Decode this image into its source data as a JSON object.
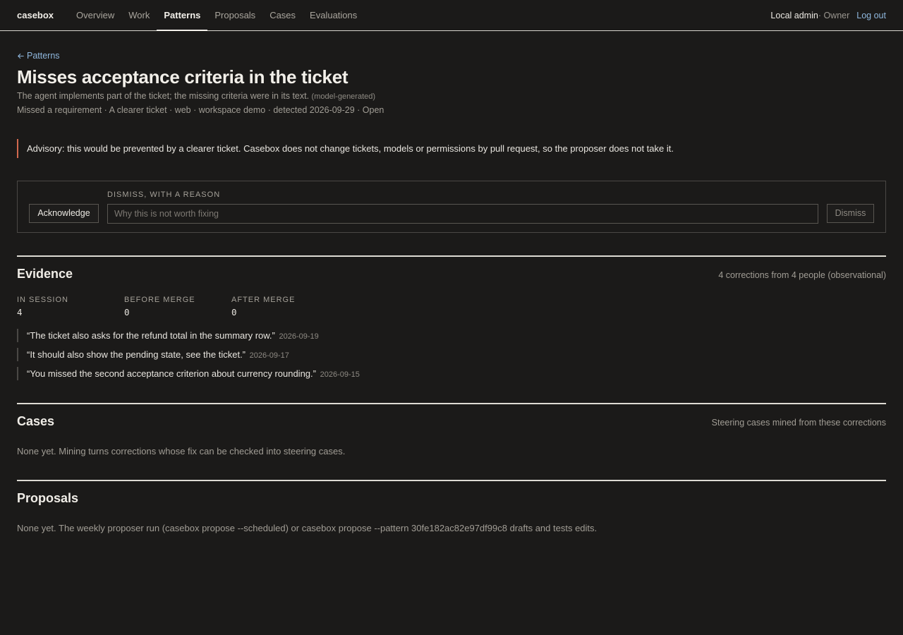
{
  "header": {
    "brand": "casebox",
    "nav": [
      {
        "label": "Overview"
      },
      {
        "label": "Work"
      },
      {
        "label": "Patterns"
      },
      {
        "label": "Proposals"
      },
      {
        "label": "Cases"
      },
      {
        "label": "Evaluations"
      }
    ],
    "active_nav": "Patterns",
    "user": "Local admin",
    "role": " · Owner",
    "logout": "Log out"
  },
  "pattern": {
    "back_label": "Patterns",
    "title": "Misses acceptance criteria in the ticket",
    "summary": "The agent implements part of the ticket; the missing criteria were in its text.",
    "summary_tag": "(model-generated)",
    "meta": "Missed a requirement · A clearer ticket · web · workspace demo · detected 2026-09-29 · Open"
  },
  "advisory": "Advisory: this would be prevented by a clearer ticket. Casebox does not change tickets, models or permissions by pull request, so the proposer does not take it.",
  "actions": {
    "acknowledge_label": "Acknowledge",
    "dismiss_heading": "Dismiss, with a reason",
    "reason_placeholder": "Why this is not worth fixing",
    "reason_value": "",
    "dismiss_label": "Dismiss"
  },
  "evidence": {
    "title": "Evidence",
    "note": "4 corrections from 4 people (observational)",
    "stats": [
      {
        "label": "In session",
        "value": "4"
      },
      {
        "label": "Before merge",
        "value": "0"
      },
      {
        "label": "After merge",
        "value": "0"
      }
    ],
    "quotes": [
      {
        "text": "“The ticket also asks for the refund total in the summary row.”",
        "date": "2026-09-19"
      },
      {
        "text": "“It should also show the pending state, see the ticket.”",
        "date": "2026-09-17"
      },
      {
        "text": "“You missed the second acceptance criterion about currency rounding.”",
        "date": "2026-09-15"
      }
    ]
  },
  "cases": {
    "title": "Cases",
    "note": "Steering cases mined from these corrections",
    "empty": "None yet. Mining turns corrections whose fix can be checked into steering cases."
  },
  "proposals": {
    "title": "Proposals",
    "empty": "None yet. The weekly proposer run (casebox propose --scheduled) or casebox propose --pattern 30fe182ac82e97df99c8 drafts and tests edits."
  }
}
